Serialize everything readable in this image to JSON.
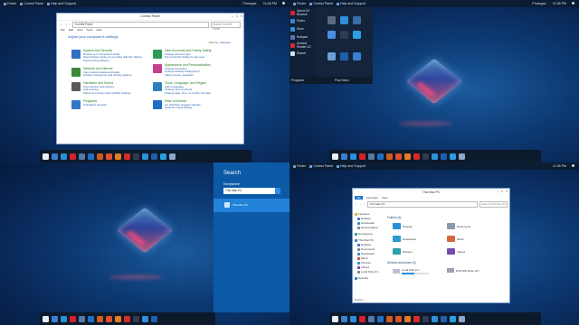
{
  "topbar": {
    "items": [
      "Finder",
      "Control Panel",
      "Help and Support"
    ],
    "time": "11:06 PM",
    "user": "Photogra..."
  },
  "control_panel": {
    "title": "Control Panel",
    "address": "Control Panel",
    "search_placeholder": "Search Control Panel",
    "menu": [
      "File",
      "Edit",
      "View",
      "Tools",
      "Help"
    ],
    "heading": "Adjust your computer's settings",
    "view_by_label": "View by:",
    "view_by_value": "Category",
    "categories": [
      {
        "title": "System and Security",
        "links": [
          "Review your computer's status",
          "Save backup copies of your files with File History",
          "Find and fix problems"
        ],
        "color": "#2e6fc2"
      },
      {
        "title": "Network and Internet",
        "links": [
          "View network status and tasks",
          "Choose homegroup and sharing options"
        ],
        "color": "#3a8a3a"
      },
      {
        "title": "Hardware and Sound",
        "links": [
          "View devices and printers",
          "Add a device",
          "Adjust commonly used mobility settings"
        ],
        "color": "#5a5a5a"
      },
      {
        "title": "Programs",
        "links": [
          "Uninstall a program"
        ],
        "color": "#3477c9"
      },
      {
        "title": "User Accounts and Family Safety",
        "links": [
          "Change account type",
          "Set up Family Safety for any user"
        ],
        "color": "#2b9a55"
      },
      {
        "title": "Appearance and Personalization",
        "links": [
          "Change the theme",
          "Change desktop background",
          "Adjust screen resolution"
        ],
        "color": "#c4408e"
      },
      {
        "title": "Clock, Language, and Region",
        "links": [
          "Add a language",
          "Change input methods",
          "Change date, time, or number formats"
        ],
        "color": "#2f7fbf"
      },
      {
        "title": "Ease of Access",
        "links": [
          "Let Windows suggest settings",
          "Optimize visual display"
        ],
        "color": "#1f6fc7"
      }
    ]
  },
  "start_menu": {
    "items": [
      {
        "label": "Opera GX Browser",
        "color": "#d6202b"
      },
      {
        "label": "Finder",
        "color": "#3b82d6"
      },
      {
        "label": "Store",
        "color": "#2f8fd8"
      },
      {
        "label": "Notepad",
        "color": "#5a7aa6"
      },
      {
        "label": "Acrobat Reader DC",
        "color": "#d62b2b"
      },
      {
        "label": "Search",
        "color": "#d7e1ec"
      }
    ],
    "footer_left": "Programs",
    "footer_right": "Pha/ Down",
    "tile_colors": [
      "#5b6b80",
      "#2f8fd8",
      "#3b6ea8",
      "#4a8fe0",
      "#2e3d52",
      "#2aa0e0",
      "#6aa0d8",
      "#1f5fae",
      "#3d7fd0"
    ]
  },
  "search": {
    "title": "Search",
    "scope": "Everywhere",
    "query": "This Mac PC",
    "result": "This Mac PC"
  },
  "explorer": {
    "title": "This Mac PC",
    "ribbon": [
      "File",
      "Computer",
      "View"
    ],
    "address": "This Mac PC",
    "search_placeholder": "Search This Mac PC",
    "nav": [
      {
        "label": "Favorites",
        "color": "#e3b341"
      },
      {
        "label": "Desktop",
        "color": "#3d7fd0"
      },
      {
        "label": "Downloads",
        "color": "#2f8fd8"
      },
      {
        "label": "Recent places",
        "color": "#8a8a8a"
      },
      {
        "label": "Homegroup",
        "color": "#2aa0a0"
      },
      {
        "label": "This Mac PC",
        "color": "#3d7fd0"
      },
      {
        "label": "Desktop",
        "color": "#3d7fd0"
      },
      {
        "label": "Documents",
        "color": "#8a8a8a"
      },
      {
        "label": "Downloads",
        "color": "#2f8fd8"
      },
      {
        "label": "Music",
        "color": "#d05a3a"
      },
      {
        "label": "Pictures",
        "color": "#2e9ad0"
      },
      {
        "label": "Videos",
        "color": "#7a4ab0"
      },
      {
        "label": "Local Disk (C:)",
        "color": "#8a8a8a"
      },
      {
        "label": "Network",
        "color": "#3d7fd0"
      }
    ],
    "folders_heading": "Folders (6)",
    "folders": [
      {
        "label": "Desktop",
        "color": "#2a8fd8"
      },
      {
        "label": "Documents",
        "color": "#8a9aad"
      },
      {
        "label": "Downloads",
        "color": "#2a9ad0"
      },
      {
        "label": "Music",
        "color": "#d06a3a"
      },
      {
        "label": "Pictures",
        "color": "#2aa0a8"
      },
      {
        "label": "Videos",
        "color": "#7a4ab0"
      }
    ],
    "devices_heading": "Devices and drives (2)",
    "drives": [
      {
        "label": "Local Disk (C:)",
        "fill": 0.45
      },
      {
        "label": "DVD RW Drive (D:)",
        "fill": 0
      }
    ],
    "status": "8 items"
  },
  "taskbar_icons": [
    "#e8eef5",
    "#3d7fd0",
    "#2a8fd8",
    "#d6202b",
    "#5a7aa6",
    "#1f6fc7",
    "#d05a1f",
    "#e0502a",
    "#e57b22",
    "#d62b2b",
    "#2e3d52",
    "#2f8fd8",
    "#1f5fae",
    "#2aa0e0",
    "#8aa7c8"
  ]
}
